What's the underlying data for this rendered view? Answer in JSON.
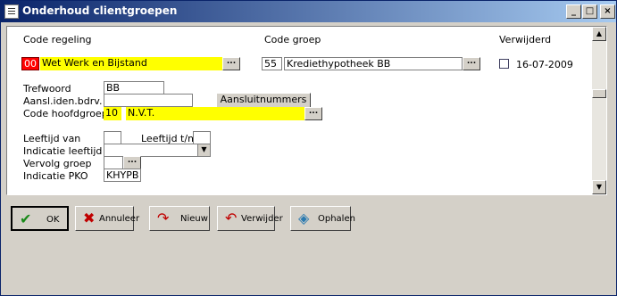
{
  "window": {
    "title": "Onderhoud clientgroepen",
    "min_icon": "minimize-icon",
    "max_icon": "maximize-icon",
    "close_icon": "close-icon"
  },
  "headers": {
    "code_regeling": "Code regeling",
    "code_groep": "Code groep",
    "verwijderd": "Verwijderd"
  },
  "row": {
    "regeling_code": "00",
    "regeling_name": "Wet Werk en Bijstand",
    "groep_code": "55",
    "groep_name": "Krediethypotheek BB",
    "verwijderd_date": "16-07-2009",
    "dots": "..."
  },
  "fields": {
    "trefwoord_label": "Trefwoord",
    "trefwoord_value": "BB",
    "aansl_label": "Aansl.iden.bdrv.",
    "aansl_value": "",
    "aansluitnummers_button": "Aansluitnummers",
    "hoofdgroep_label": "Code hoofdgroep",
    "hoofdgroep_code": "10",
    "hoofdgroep_name": "N.V.T.",
    "leeftijd_van_label": "Leeftijd van",
    "leeftijd_van_value": "",
    "leeftijd_tm_label": "Leeftijd t/m",
    "leeftijd_tm_value": "",
    "indicatie_leeftijd_label": "Indicatie leeftijd",
    "indicatie_leeftijd_value": "",
    "vervolg_groep_label": "Vervolg groep",
    "vervolg_groep_value": "",
    "indicatie_pko_label": "Indicatie PKO",
    "indicatie_pko_value": "KHYPB"
  },
  "buttons": {
    "ok": "OK",
    "annuleer": "Annuleer",
    "nieuw": "Nieuw",
    "verwijder": "Verwijder",
    "ophalen": "Ophalen"
  },
  "colors": {
    "highlight": "#ffff00",
    "selected_code": "#ff0000",
    "titlebar": "#0a246a"
  }
}
